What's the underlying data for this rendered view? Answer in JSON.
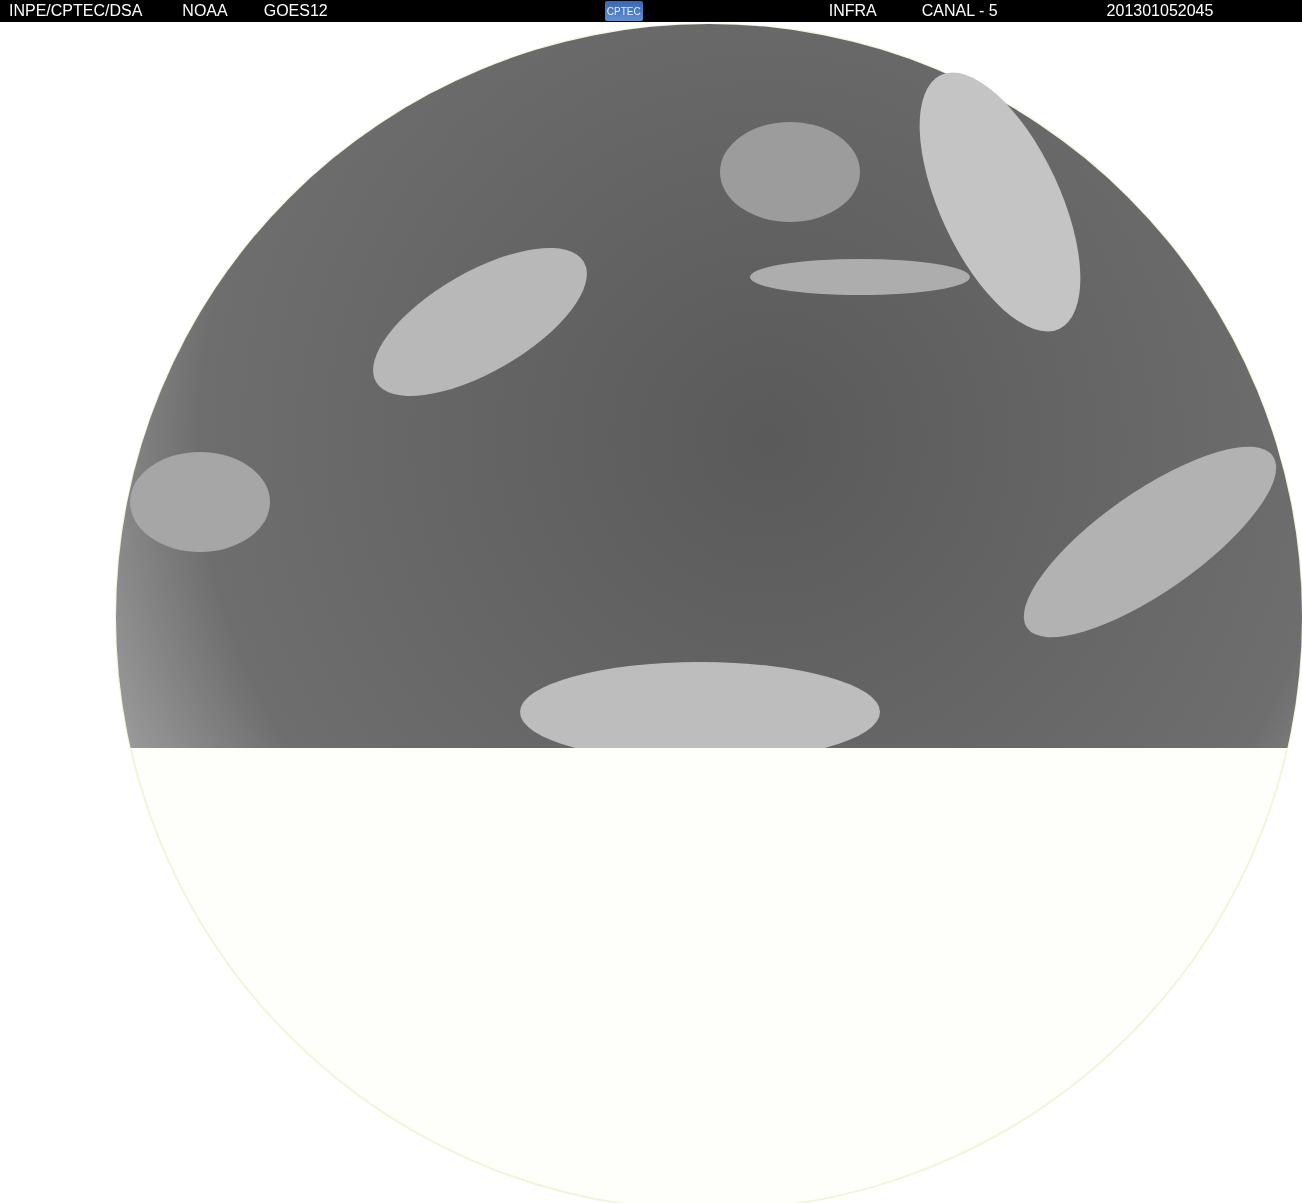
{
  "header": {
    "source": "INPE/CPTEC/DSA",
    "agency": "NOAA",
    "satellite": "GOES12",
    "logo": "CPTEC",
    "band": "INFRA",
    "channel": "CANAL - 5",
    "timestamp": "201301052045"
  }
}
